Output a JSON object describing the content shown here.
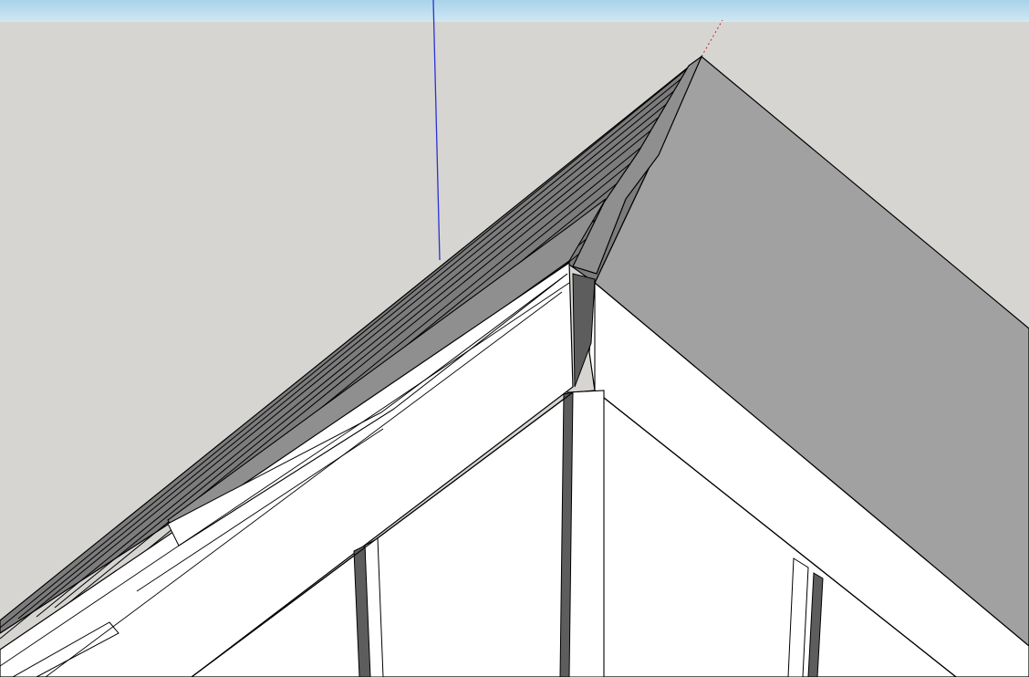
{
  "app": {
    "view": "3d-model-viewport",
    "tool": "orbit"
  },
  "colors": {
    "sky_top": "#a8d3ea",
    "sky_bottom": "#d0e7f3",
    "ground": "#d7d5d1",
    "roof_dark": "#7c7c7c",
    "roof_mid": "#8f8f8f",
    "roof_light": "#a1a1a1",
    "wall_white": "#ffffff",
    "trim_shadow": "#5d5d5d",
    "edge": "#000000",
    "axis_blue": "#2a32d6",
    "axis_red": "#c62a2a"
  },
  "scene": {
    "axes": [
      "blue-axis",
      "red-axis"
    ],
    "model": "gable-roof-corner"
  }
}
